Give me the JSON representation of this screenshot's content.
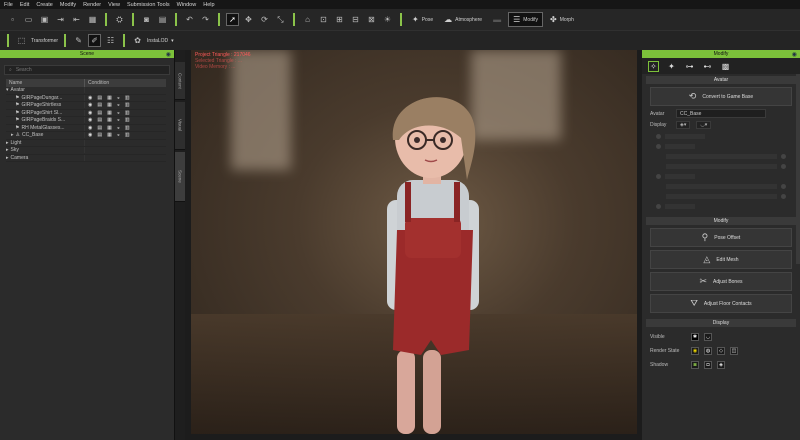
{
  "menu": [
    "File",
    "Edit",
    "Create",
    "Modify",
    "Render",
    "View",
    "Submission Tools",
    "Window",
    "Help"
  ],
  "toolbar": {
    "pose_label": "Pose",
    "atmosphere_label": "Atmosphere",
    "modify_label": "Modify",
    "morph_label": "Morph"
  },
  "toolbar2": {
    "transformer_label": "Transformer",
    "instalod_label": "InstaLOD"
  },
  "scene": {
    "title": "Scene",
    "search_placeholder": "Search",
    "col_name": "Name",
    "col_condition": "Condition",
    "rows": [
      {
        "label": "Avatar"
      },
      {
        "label": "GIRPageDungar..."
      },
      {
        "label": "GIRPageShirtless"
      },
      {
        "label": "GIRPageShirt Sl..."
      },
      {
        "label": "GIRPageBraids S..."
      },
      {
        "label": "RH MetalGlasses..."
      },
      {
        "label": "CC_Base"
      },
      {
        "label": "Light"
      },
      {
        "label": "Sky"
      },
      {
        "label": "Camera"
      }
    ]
  },
  "side_tabs": [
    "Content",
    "Visual",
    "Scene"
  ],
  "viewport": {
    "stats_line1": "Project Triangle : 217046",
    "stats_line2": "Selected Triangle : ...",
    "stats_line3": "Video Memory : ..."
  },
  "modify": {
    "title": "Modify",
    "avatar_section": "Avatar",
    "convert_label": "Convert to Game Base",
    "avatar_field_label": "Avatar",
    "avatar_value": "CC_Base",
    "display_label": "Display",
    "modify_section": "Modify",
    "pose_offset_label": "Pose Offset",
    "edit_mesh_label": "Edit Mesh",
    "adjust_bones_label": "Adjust Bones",
    "adjust_floor_label": "Adjust Floor Contacts",
    "display_section": "Display",
    "visible_label": "Visible",
    "render_state_label": "Render State",
    "shadow_label": "Shadow"
  },
  "colors": {
    "accent": "#7cc13a",
    "stats": "#ff5a5a"
  }
}
